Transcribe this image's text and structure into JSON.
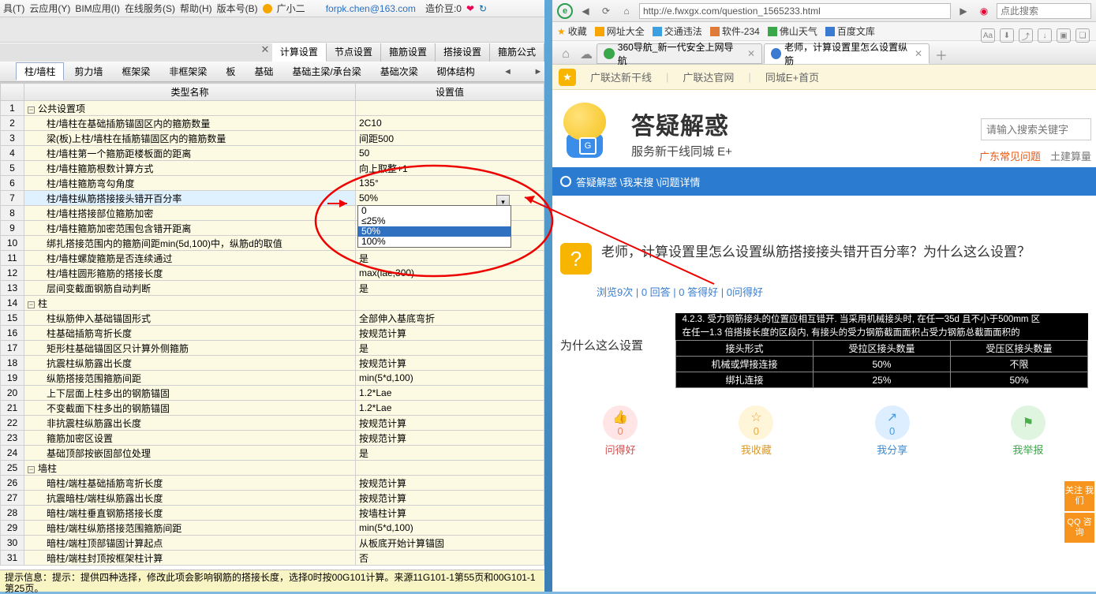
{
  "left": {
    "menu": [
      "具(T)",
      "云应用(Y)",
      "BIM应用(I)",
      "在线服务(S)",
      "帮助(H)",
      "版本号(B)"
    ],
    "menu_extra": "广小二",
    "email": "forpk.chen@163.com",
    "credits_label": "造价豆:0",
    "inner_tabs": [
      "计算设置",
      "节点设置",
      "箍筋设置",
      "搭接设置",
      "箍筋公式"
    ],
    "inner_tab_active": 0,
    "sub_tabs": [
      "柱/墙柱",
      "剪力墙",
      "框架梁",
      "非框架梁",
      "板",
      "基础",
      "基础主梁/承台梁",
      "基础次梁",
      "砌体结构"
    ],
    "sub_tab_active": 0,
    "grid_headers": [
      "类型名称",
      "设置值"
    ],
    "rows": [
      {
        "n": 1,
        "t": "公共设置项",
        "v": "",
        "group": true
      },
      {
        "n": 2,
        "t": "柱/墙柱在基础插筋锚固区内的箍筋数量",
        "v": "2C10"
      },
      {
        "n": 3,
        "t": "梁(板)上柱/墙柱在插筋锚固区内的箍筋数量",
        "v": "间距500"
      },
      {
        "n": 4,
        "t": "柱/墙柱第一个箍筋距楼板面的距离",
        "v": "50"
      },
      {
        "n": 5,
        "t": "柱/墙柱箍筋根数计算方式",
        "v": "向上取整+1"
      },
      {
        "n": 6,
        "t": "柱/墙柱箍筋弯勾角度",
        "v": "135°"
      },
      {
        "n": 7,
        "t": "柱/墙柱纵筋搭接接头错开百分率",
        "v": "50%",
        "sel": true
      },
      {
        "n": 8,
        "t": "柱/墙柱搭接部位箍筋加密",
        "v": ""
      },
      {
        "n": 9,
        "t": "柱/墙柱箍筋加密范围包含错开距离",
        "v": ""
      },
      {
        "n": 10,
        "t": "绑扎搭接范围内的箍筋间距min(5d,100)中，纵筋d的取值",
        "v": ""
      },
      {
        "n": 11,
        "t": "柱/墙柱螺旋箍筋是否连续通过",
        "v": "是"
      },
      {
        "n": 12,
        "t": "柱/墙柱圆形箍筋的搭接长度",
        "v": "max(lae,300)"
      },
      {
        "n": 13,
        "t": "层间变截面钢筋自动判断",
        "v": "是"
      },
      {
        "n": 14,
        "t": "柱",
        "v": "",
        "group": true
      },
      {
        "n": 15,
        "t": "柱纵筋伸入基础锚固形式",
        "v": "全部伸入基底弯折"
      },
      {
        "n": 16,
        "t": "柱基础插筋弯折长度",
        "v": "按规范计算"
      },
      {
        "n": 17,
        "t": "矩形柱基础锚固区只计算外侧箍筋",
        "v": "是"
      },
      {
        "n": 18,
        "t": "抗震柱纵筋露出长度",
        "v": "按规范计算"
      },
      {
        "n": 19,
        "t": "纵筋搭接范围箍筋间距",
        "v": "min(5*d,100)"
      },
      {
        "n": 20,
        "t": "上下层面上柱多出的钢筋锚固",
        "v": "1.2*Lae"
      },
      {
        "n": 21,
        "t": "不变截面下柱多出的钢筋锚固",
        "v": "1.2*Lae"
      },
      {
        "n": 22,
        "t": "非抗震柱纵筋露出长度",
        "v": "按规范计算"
      },
      {
        "n": 23,
        "t": "箍筋加密区设置",
        "v": "按规范计算"
      },
      {
        "n": 24,
        "t": "基础顶部按嵌固部位处理",
        "v": "是"
      },
      {
        "n": 25,
        "t": "墙柱",
        "v": "",
        "group": true
      },
      {
        "n": 26,
        "t": "暗柱/端柱基础插筋弯折长度",
        "v": "按规范计算"
      },
      {
        "n": 27,
        "t": "抗震暗柱/端柱纵筋露出长度",
        "v": "按规范计算"
      },
      {
        "n": 28,
        "t": "暗柱/端柱垂直钢筋搭接长度",
        "v": "按墙柱计算"
      },
      {
        "n": 29,
        "t": "暗柱/端柱纵筋搭接范围箍筋间距",
        "v": "min(5*d,100)"
      },
      {
        "n": 30,
        "t": "暗柱/端柱顶部锚固计算起点",
        "v": "从板底开始计算锚固"
      },
      {
        "n": 31,
        "t": "暗柱/端柱封顶按框架柱计算",
        "v": "否"
      }
    ],
    "dropdown": [
      "0",
      "≤25%",
      "50%",
      "100%"
    ],
    "dropdown_sel": 2,
    "hint": "提示信息：提示：提供四种选择，修改此项会影响钢筋的搭接长度，选择0时按00G101计算。来源11G101-1第55页和00G101-1第25页。"
  },
  "right": {
    "url": "http://e.fwxgx.com/question_1565233.html",
    "search_ph": "点此搜索",
    "bookmarks": [
      {
        "icon": "star",
        "c": "#f7a500",
        "label": "收藏"
      },
      {
        "icon": "sq",
        "c": "#f7a500",
        "label": "网址大全"
      },
      {
        "icon": "sq",
        "c": "#3aa0e0",
        "label": "交通违法"
      },
      {
        "icon": "sq",
        "c": "#e07a3a",
        "label": "软件-234"
      },
      {
        "icon": "sq",
        "c": "#3aa84a",
        "label": "佛山天气"
      },
      {
        "icon": "sq",
        "c": "#3a7ad0",
        "label": "百度文库"
      }
    ],
    "toolbar_icons": [
      "Aa",
      "⬇",
      "⤴",
      "↓",
      "▣",
      "❏"
    ],
    "tabs": [
      {
        "icon": "#3aa84a",
        "label": "360导航_新一代安全上网导航",
        "active": false
      },
      {
        "icon": "#3a7ad0",
        "label": "老师，计算设置里怎么设置纵筋",
        "active": true
      }
    ],
    "nav2": [
      "广联达新干线",
      "广联达官网",
      "同城E+首页"
    ],
    "hero_title": "答疑解惑",
    "hero_sub": "服务新干线同城 E+",
    "search2_ph": "请输入搜索关键字",
    "reg_links": [
      "广东常见问题",
      "土建算量"
    ],
    "breadcrumb": "答疑解惑 \\我来搜 \\问题详情",
    "question": "老师，计算设置里怎么设置纵筋搭接接头错开百分率？为什么这么设置？",
    "stats": "浏览9次 | 0 回答 | 0 答得好 | 0问得好",
    "answer_label": "为什么这么设置",
    "spec_line1": "4.2.3. 受力钢筋接头的位置应相互错开. 当采用机械接头时, 在任一35d 且不小于500mm 区",
    "spec_line2": "在任一1.3 倍搭接长度的区段内, 有接头的受力钢筋截面面积占受力钢筋总截面面积的",
    "spec_headers": [
      "接头形式",
      "受拉区接头数量",
      "受压区接头数量"
    ],
    "spec_rows": [
      [
        "机械或焊接连接",
        "50%",
        "不限"
      ],
      [
        "绑扎连接",
        "25%",
        "50%"
      ]
    ],
    "actions": [
      {
        "icon": "👍",
        "n": "0",
        "label": "问得好",
        "cls": "red"
      },
      {
        "icon": "☆",
        "n": "0",
        "label": "我收藏",
        "cls": "yel"
      },
      {
        "icon": "↗",
        "n": "0",
        "label": "我分享",
        "cls": "blu"
      },
      {
        "icon": "⚑",
        "n": "",
        "label": "我举报",
        "cls": "grn"
      }
    ],
    "side_btns": [
      "关注\n我们",
      "QQ\n咨询"
    ]
  }
}
